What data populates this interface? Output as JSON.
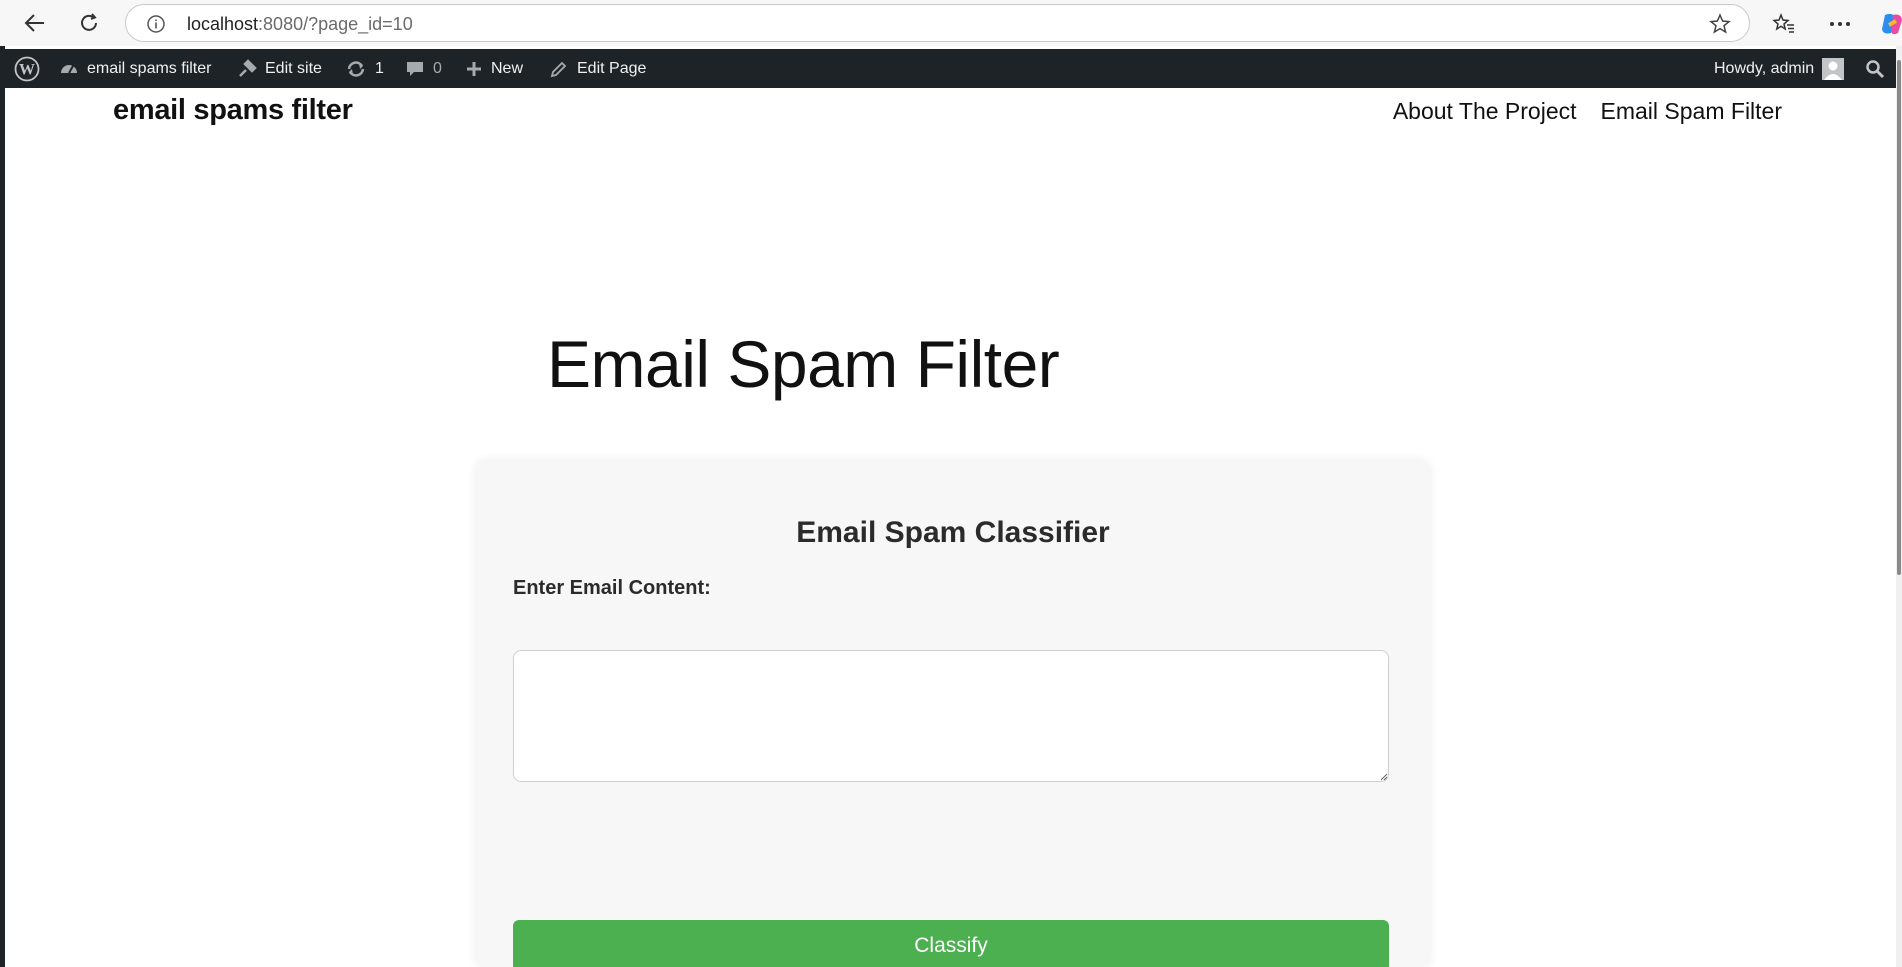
{
  "browser": {
    "url_host": "localhost",
    "url_path": ":8080/?page_id=10",
    "icons": [
      "back-icon",
      "refresh-icon",
      "info-icon",
      "star-icon",
      "favorites-icon",
      "more-icon",
      "copilot-icon"
    ]
  },
  "adminbar": {
    "site_name": "email spams filter",
    "edit_site": "Edit site",
    "updates_count": "1",
    "comments_count": "0",
    "new_label": "New",
    "edit_page": "Edit Page",
    "howdy": "Howdy, admin"
  },
  "site": {
    "title": "email spams filter",
    "nav": {
      "about": "About The Project",
      "filter": "Email Spam Filter"
    }
  },
  "page": {
    "title": "Email Spam Filter"
  },
  "classifier": {
    "heading": "Email Spam Classifier",
    "label": "Enter Email Content:",
    "textarea_value": "",
    "button": "Classify",
    "button_color": "#4caf50"
  }
}
